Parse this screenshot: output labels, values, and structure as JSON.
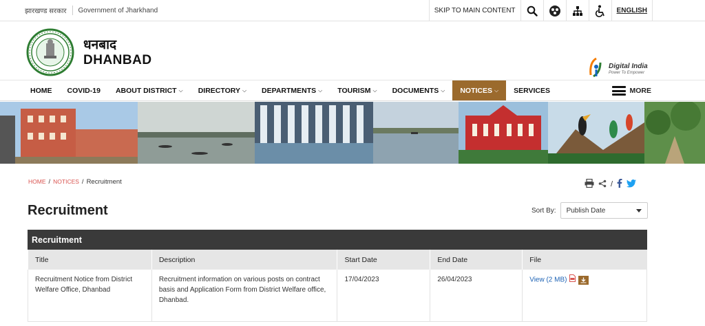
{
  "topbar": {
    "hindi_label": "झारखण्ड सरकार",
    "gov_label": "Government of Jharkhand",
    "skip_label": "SKIP TO MAIN CONTENT",
    "lang_label": "ENGLISH"
  },
  "header": {
    "hindi_name": "धनबाद",
    "site_name": "DHANBAD",
    "digital_india_title": "Digital India",
    "digital_india_tagline": "Power To Empower"
  },
  "nav": {
    "items": [
      {
        "label": "HOME",
        "dropdown": false
      },
      {
        "label": "COVID-19",
        "dropdown": false
      },
      {
        "label": "ABOUT DISTRICT",
        "dropdown": true
      },
      {
        "label": "DIRECTORY",
        "dropdown": true
      },
      {
        "label": "DEPARTMENTS",
        "dropdown": true
      },
      {
        "label": "TOURISM",
        "dropdown": true
      },
      {
        "label": "DOCUMENTS",
        "dropdown": true
      },
      {
        "label": "NOTICES",
        "dropdown": true,
        "active": true
      },
      {
        "label": "SERVICES",
        "dropdown": false
      }
    ],
    "more_label": "MORE",
    "active_color": "#9b6a2d"
  },
  "breadcrumb": {
    "home": "HOME",
    "notices": "NOTICES",
    "current": "Recruitment"
  },
  "page": {
    "title": "Recruitment",
    "sort_label": "Sort By:",
    "sort_value": "Publish Date"
  },
  "table": {
    "caption": "Recruitment",
    "headers": [
      "Title",
      "Description",
      "Start Date",
      "End Date",
      "File"
    ],
    "rows": [
      {
        "title": "Recruitment Notice from District Welfare Office, Dhanbad",
        "description": "Recruitment information on various posts on contract basis and Application Form from District Welfare office, Dhanbad.",
        "start_date": "17/04/2023",
        "end_date": "26/04/2023",
        "file_label": "View (2 MB)"
      }
    ]
  }
}
